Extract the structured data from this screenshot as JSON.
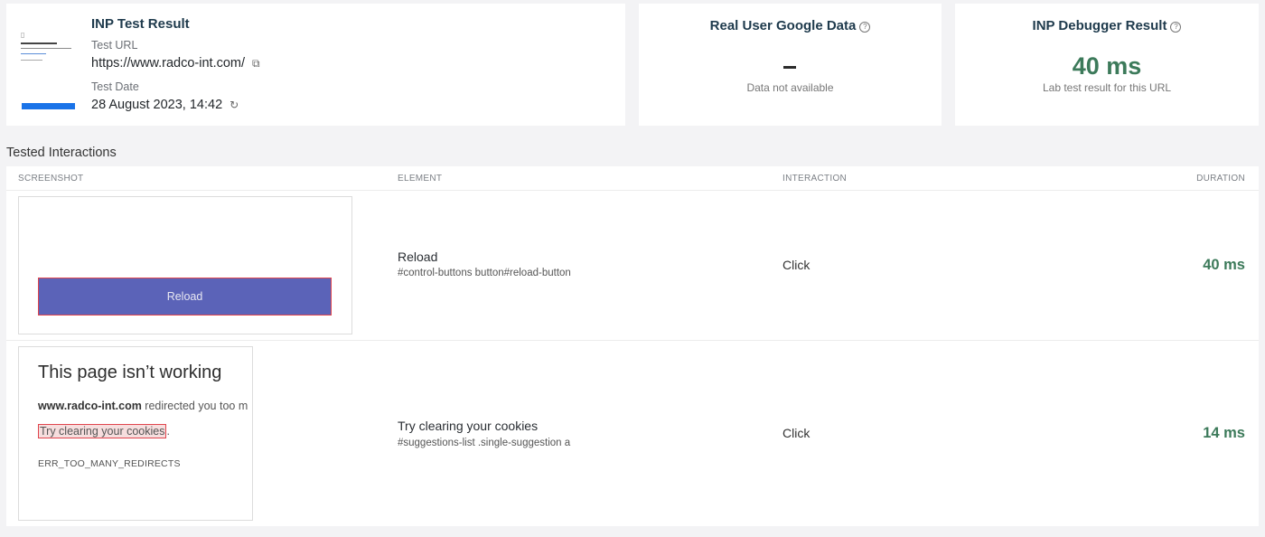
{
  "result_card": {
    "title": "INP Test Result",
    "url_label": "Test URL",
    "url": "https://www.radco-int.com/",
    "date_label": "Test Date",
    "date": "28 August 2023, 14:42"
  },
  "google_card": {
    "title": "Real User Google Data",
    "value": "–",
    "subtitle": "Data not available"
  },
  "debugger_card": {
    "title": "INP Debugger Result",
    "value": "40 ms",
    "subtitle": "Lab test result for this URL"
  },
  "section_title": "Tested Interactions",
  "table": {
    "columns": [
      "SCREENSHOT",
      "ELEMENT",
      "INTERACTION",
      "DURATION"
    ],
    "rows": [
      {
        "screenshot_button": "Reload",
        "element": "Reload",
        "selector": "#control-buttons button#reload-button",
        "interaction": "Click",
        "duration": "40 ms"
      },
      {
        "screenshot_title": "This page isn’t working",
        "screenshot_domain": "www.radco-int.com",
        "screenshot_text": " redirected you too m",
        "screenshot_link": "Try clearing your cookies",
        "screenshot_link_suffix": ".",
        "screenshot_error": "ERR_TOO_MANY_REDIRECTS",
        "element": "Try clearing your cookies",
        "selector": "#suggestions-list .single-suggestion a",
        "interaction": "Click",
        "duration": "14 ms"
      }
    ]
  },
  "icons": [
    "document-icon",
    "external-link-icon",
    "refresh-icon",
    "help-icon"
  ]
}
